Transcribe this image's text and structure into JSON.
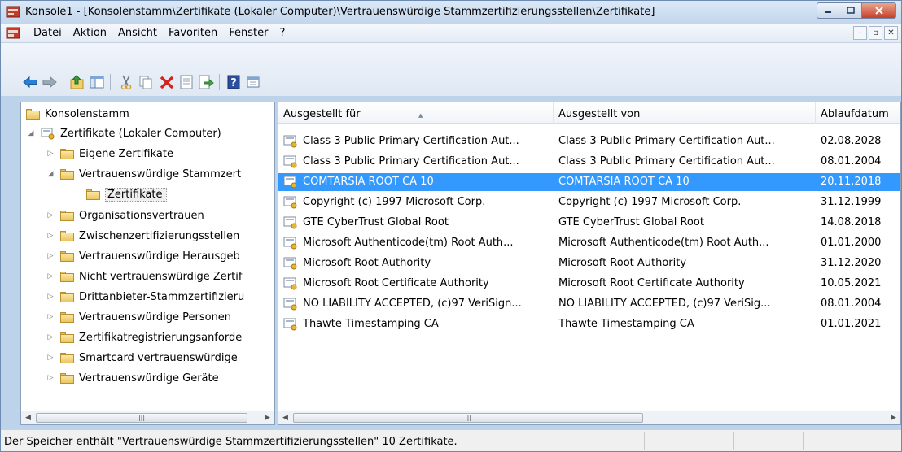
{
  "window": {
    "title": "Konsole1 - [Konsolenstamm\\Zertifikate (Lokaler Computer)\\Vertrauenswürdige Stammzertifizierungsstellen\\Zertifikate]"
  },
  "menu": {
    "items": [
      "Datei",
      "Aktion",
      "Ansicht",
      "Favoriten",
      "Fenster",
      "?"
    ]
  },
  "toolbar": {
    "icons": [
      "back-icon",
      "forward-icon",
      "up-icon",
      "show-hide-tree-icon",
      "cut-icon",
      "copy-icon",
      "delete-icon",
      "properties-icon",
      "export-icon",
      "help-icon",
      "console-tree-icon"
    ]
  },
  "tree": {
    "nodes": [
      {
        "label": "Konsolenstamm"
      },
      {
        "label": "Zertifikate (Lokaler Computer)"
      },
      {
        "label": "Eigene Zertifikate"
      },
      {
        "label": "Vertrauenswürdige Stammzert"
      },
      {
        "label": "Zertifikate"
      },
      {
        "label": "Organisationsvertrauen"
      },
      {
        "label": "Zwischenzertifizierungsstellen"
      },
      {
        "label": "Vertrauenswürdige Herausgeb"
      },
      {
        "label": "Nicht vertrauenswürdige Zertif"
      },
      {
        "label": "Drittanbieter-Stammzertifizieru"
      },
      {
        "label": "Vertrauenswürdige Personen"
      },
      {
        "label": "Zertifikatregistrierungsanforde"
      },
      {
        "label": "Smartcard vertrauenswürdige"
      },
      {
        "label": "Vertrauenswürdige Geräte"
      }
    ]
  },
  "list": {
    "headers": [
      "Ausgestellt für",
      "Ausgestellt von",
      "Ablaufdatum"
    ],
    "rows": [
      {
        "issued_to": "Class 3 Public Primary Certification Aut...",
        "issued_by": "Class 3 Public Primary Certification Aut...",
        "expires": "02.08.2028"
      },
      {
        "issued_to": "Class 3 Public Primary Certification Aut...",
        "issued_by": "Class 3 Public Primary Certification Aut...",
        "expires": "08.01.2004"
      },
      {
        "issued_to": "COMTARSIA ROOT CA 10",
        "issued_by": "COMTARSIA ROOT CA 10",
        "expires": "20.11.2018"
      },
      {
        "issued_to": "Copyright (c) 1997 Microsoft Corp.",
        "issued_by": "Copyright (c) 1997 Microsoft Corp.",
        "expires": "31.12.1999"
      },
      {
        "issued_to": "GTE CyberTrust Global Root",
        "issued_by": "GTE CyberTrust Global Root",
        "expires": "14.08.2018"
      },
      {
        "issued_to": "Microsoft Authenticode(tm) Root Auth...",
        "issued_by": "Microsoft Authenticode(tm) Root Auth...",
        "expires": "01.01.2000"
      },
      {
        "issued_to": "Microsoft Root Authority",
        "issued_by": "Microsoft Root Authority",
        "expires": "31.12.2020"
      },
      {
        "issued_to": "Microsoft Root Certificate Authority",
        "issued_by": "Microsoft Root Certificate Authority",
        "expires": "10.05.2021"
      },
      {
        "issued_to": "NO LIABILITY ACCEPTED, (c)97 VeriSign...",
        "issued_by": "NO LIABILITY ACCEPTED, (c)97 VeriSig...",
        "expires": "08.01.2004"
      },
      {
        "issued_to": "Thawte Timestamping CA",
        "issued_by": "Thawte Timestamping CA",
        "expires": "01.01.2021"
      }
    ],
    "selected_row": "COMTARSIA ROOT CA 10"
  },
  "status": {
    "text": "Der Speicher enthält \"Vertrauenswürdige Stammzertifizierungsstellen\" 10 Zertifikate."
  },
  "colors": {
    "selection": "#3399ff",
    "title_bar": "#c3d6ec",
    "close_button": "#c7402a"
  }
}
